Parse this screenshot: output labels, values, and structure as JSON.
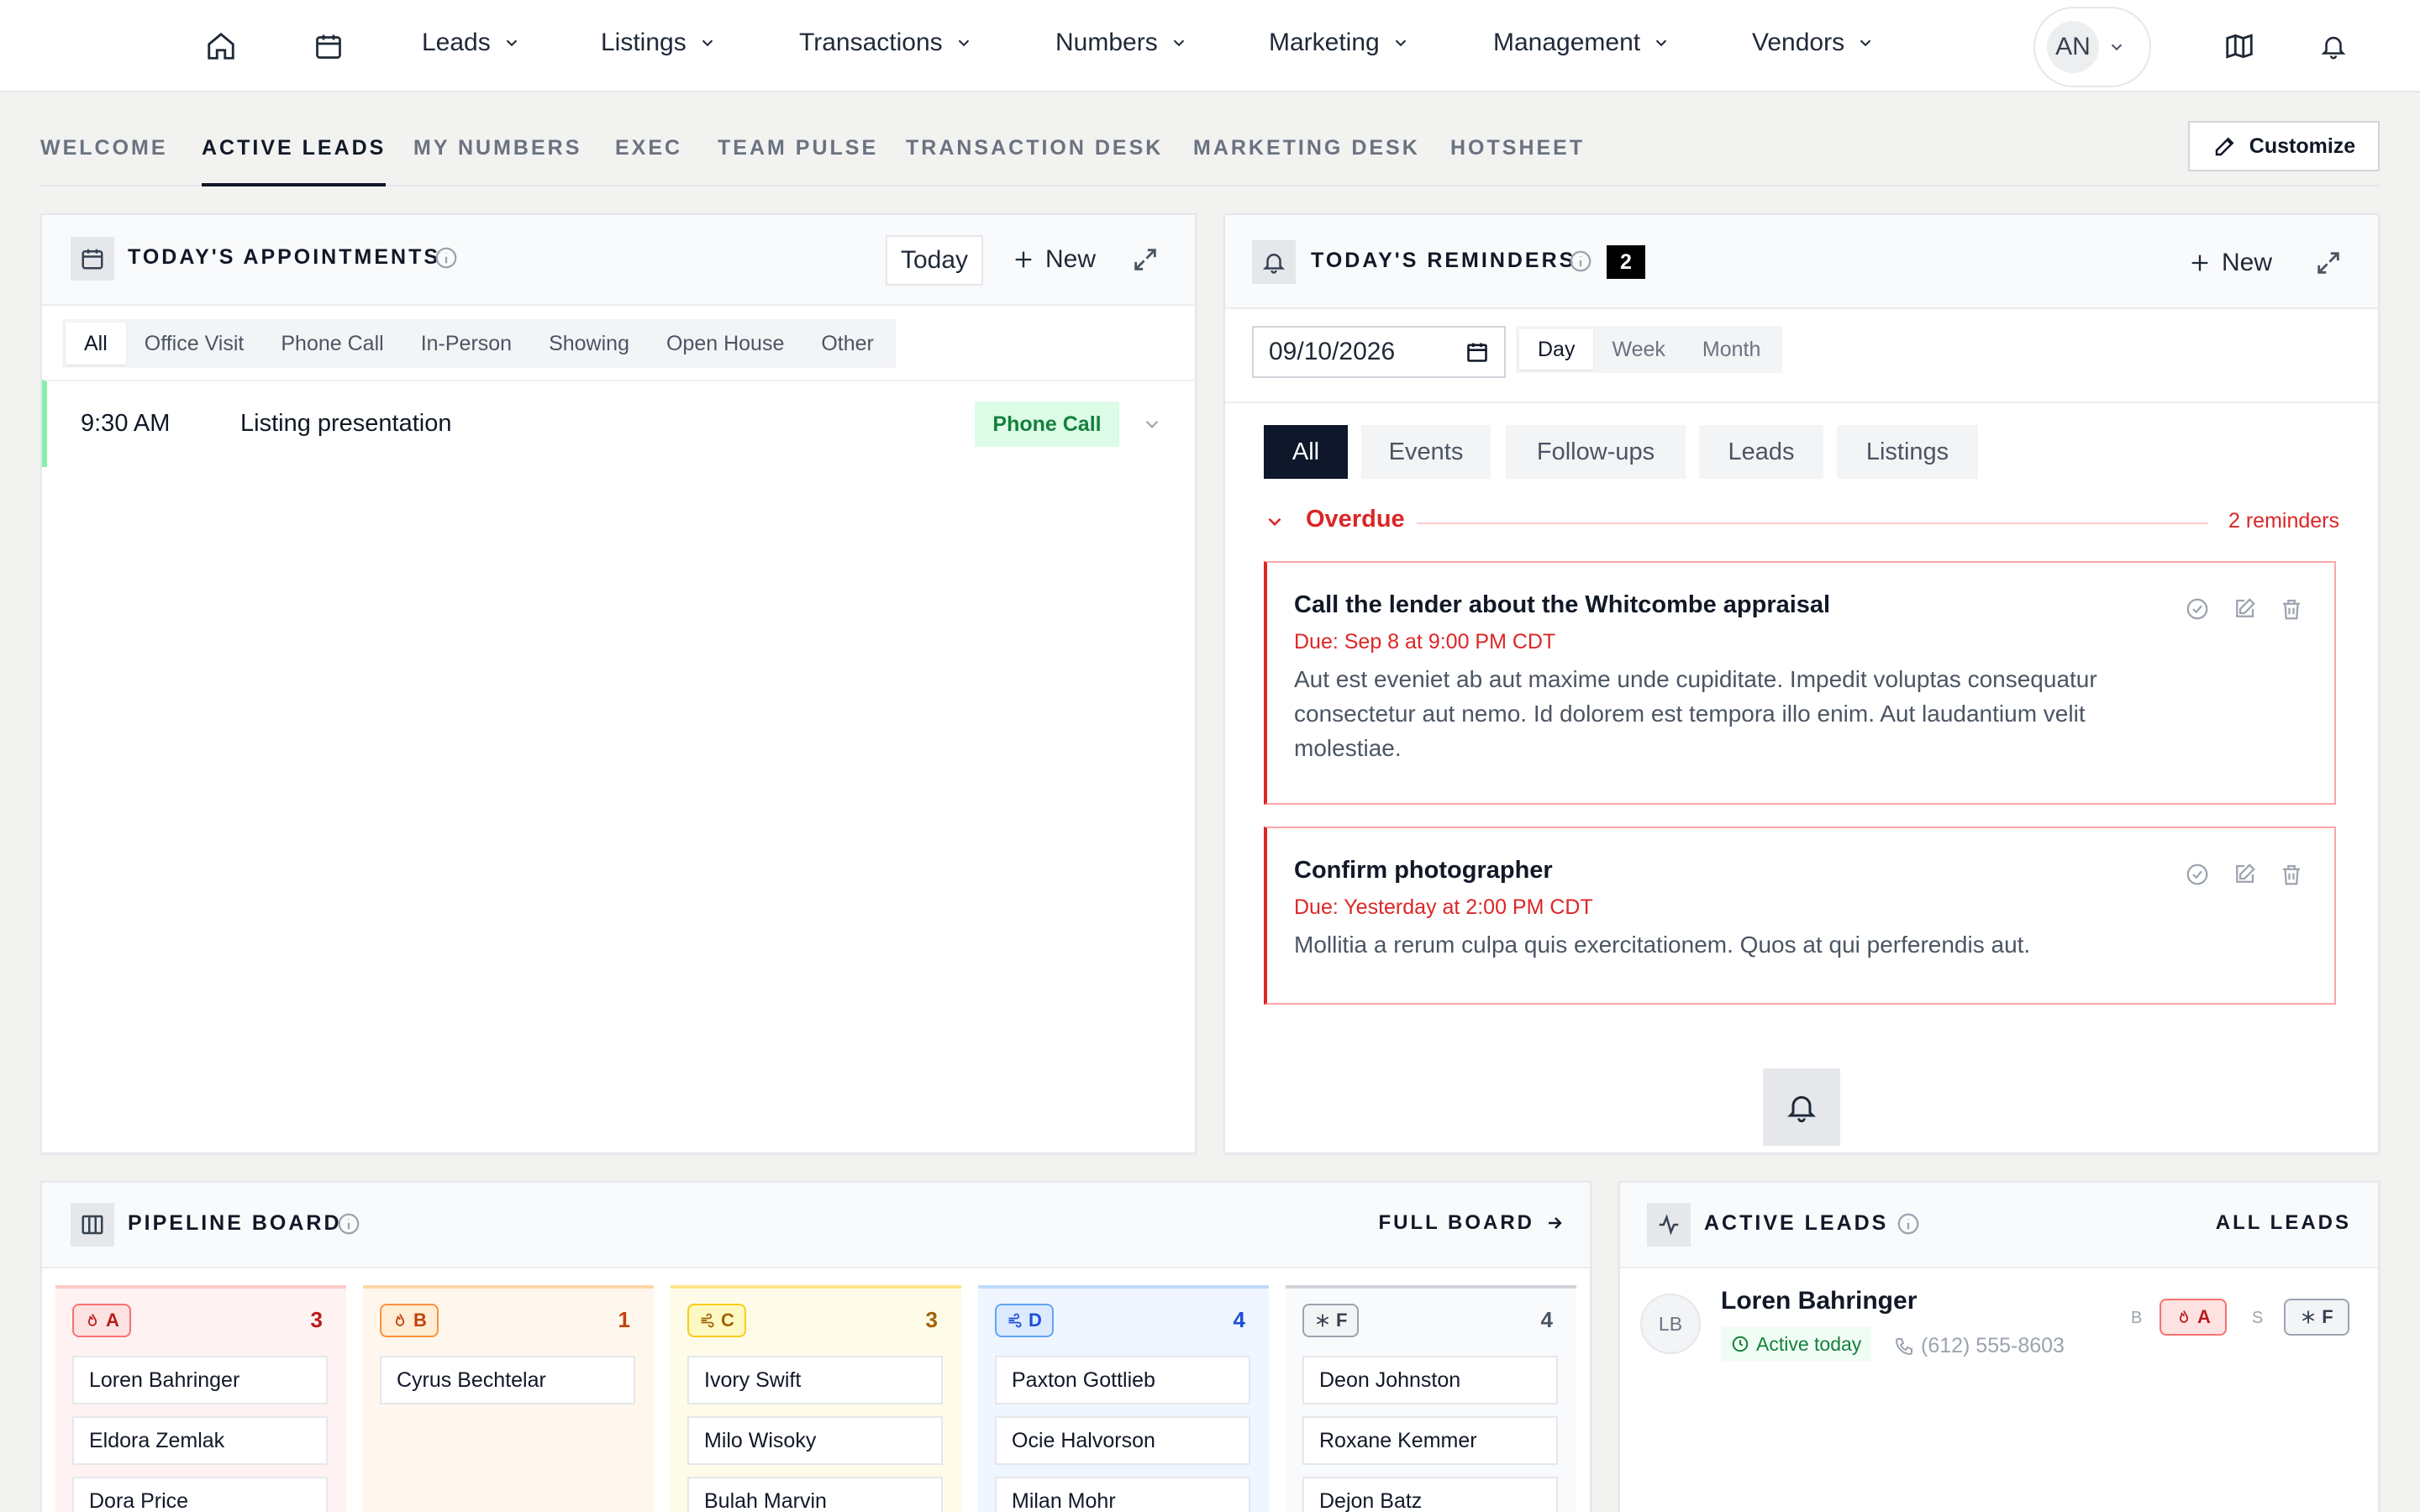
{
  "topnav": {
    "menus": [
      {
        "label": "Leads"
      },
      {
        "label": "Listings"
      },
      {
        "label": "Transactions"
      },
      {
        "label": "Numbers"
      },
      {
        "label": "Marketing"
      },
      {
        "label": "Management"
      },
      {
        "label": "Vendors"
      }
    ],
    "avatar_initials": "AN"
  },
  "subtabs": {
    "items": [
      "WELCOME",
      "ACTIVE LEADS",
      "MY NUMBERS",
      "EXEC",
      "TEAM PULSE",
      "TRANSACTION DESK",
      "MARKETING DESK",
      "HOTSHEET"
    ],
    "active": "ACTIVE LEADS",
    "customize_label": "Customize"
  },
  "appointments": {
    "title": "TODAY'S APPOINTMENTS",
    "today_label": "Today",
    "new_label": "New",
    "filters": [
      "All",
      "Office Visit",
      "Phone Call",
      "In-Person",
      "Showing",
      "Open House",
      "Other"
    ],
    "active_filter": "All",
    "items": [
      {
        "time": "9:30 AM",
        "title": "Listing presentation",
        "type": "Phone Call"
      }
    ]
  },
  "reminders": {
    "title": "TODAY'S REMINDERS",
    "count": "2",
    "new_label": "New",
    "date_value": "09/10/2026",
    "range_options": [
      "Day",
      "Week",
      "Month"
    ],
    "active_range": "Day",
    "filters": [
      "All",
      "Events",
      "Follow-ups",
      "Leads",
      "Listings"
    ],
    "active_filter": "All",
    "overdue": {
      "label": "Overdue",
      "count_text": "2 reminders",
      "items": [
        {
          "title": "Call the lender about the Whitcombe appraisal",
          "due": "Due: Sep 8 at 9:00 PM CDT",
          "body": "Aut est eveniet ab aut maxime unde cupiditate. Impedit voluptas consequatur consectetur aut nemo. Id dolorem est tempora illo enim. Aut laudantium velit molestiae."
        },
        {
          "title": "Confirm photographer",
          "due": "Due: Yesterday at 2:00 PM CDT",
          "body": "Mollitia a rerum culpa quis exercitationem. Quos at qui perferendis aut."
        }
      ]
    }
  },
  "pipeline": {
    "title": "PIPELINE BOARD",
    "full_board_label": "FULL BOARD",
    "columns": [
      {
        "grade": "A",
        "count": "3",
        "leads": [
          "Loren Bahringer",
          "Eldora Zemlak",
          "Dora Price"
        ]
      },
      {
        "grade": "B",
        "count": "1",
        "leads": [
          "Cyrus Bechtelar"
        ]
      },
      {
        "grade": "C",
        "count": "3",
        "leads": [
          "Ivory Swift",
          "Milo Wisoky",
          "Bulah Marvin"
        ]
      },
      {
        "grade": "D",
        "count": "4",
        "leads": [
          "Paxton Gottlieb",
          "Ocie Halvorson",
          "Milan Mohr"
        ]
      },
      {
        "grade": "F",
        "count": "4",
        "leads": [
          "Deon Johnston",
          "Roxane Kemmer",
          "Dejon Batz"
        ]
      }
    ]
  },
  "active_leads": {
    "title": "ACTIVE LEADS",
    "all_leads_label": "ALL LEADS",
    "items": [
      {
        "initials": "LB",
        "name": "Loren Bahringer",
        "activity": "Active today",
        "phone": "(612) 555-8603",
        "buyer_label": "B",
        "buyer_grade": "A",
        "seller_label": "S",
        "seller_grade": "F"
      }
    ]
  }
}
